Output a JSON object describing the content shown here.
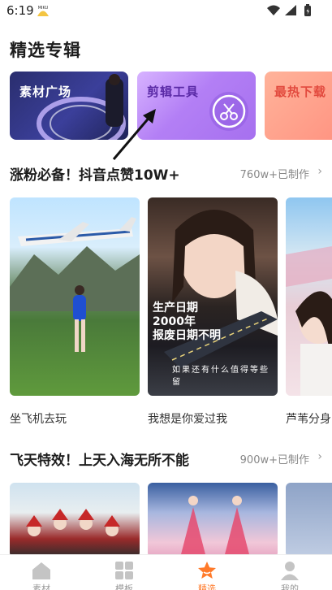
{
  "status_bar": {
    "time": "6:19",
    "avatar_text": "MIKU"
  },
  "page": {
    "title": "精选专辑"
  },
  "albums": [
    {
      "label": "素材广场"
    },
    {
      "label": "剪辑工具"
    },
    {
      "label": "最热下载"
    }
  ],
  "rows": [
    {
      "title": "涨粉必备！抖音点赞10W+",
      "count": "760w+已制作",
      "chevron": "›",
      "cards": [
        {
          "caption": "坐飞机去玩"
        },
        {
          "caption": "我想是你爱过我",
          "overlay_lines": [
            "生产日期",
            "2000年",
            "报废日期不明"
          ],
          "overlay_small": "如果还有什么值得等些留"
        },
        {
          "caption": "芦苇分身"
        }
      ]
    },
    {
      "title": "飞天特效！上天入海无所不能",
      "count": "900w+已制作",
      "chevron": "›"
    }
  ],
  "tabs": [
    {
      "label": "素材",
      "icon": "house-icon"
    },
    {
      "label": "模板",
      "icon": "grid-icon"
    },
    {
      "label": "精选",
      "icon": "star-icon",
      "active": true
    },
    {
      "label": "我的",
      "icon": "person-icon"
    }
  ],
  "colors": {
    "accent": "#ff7a2a",
    "inactive": "#999999"
  }
}
